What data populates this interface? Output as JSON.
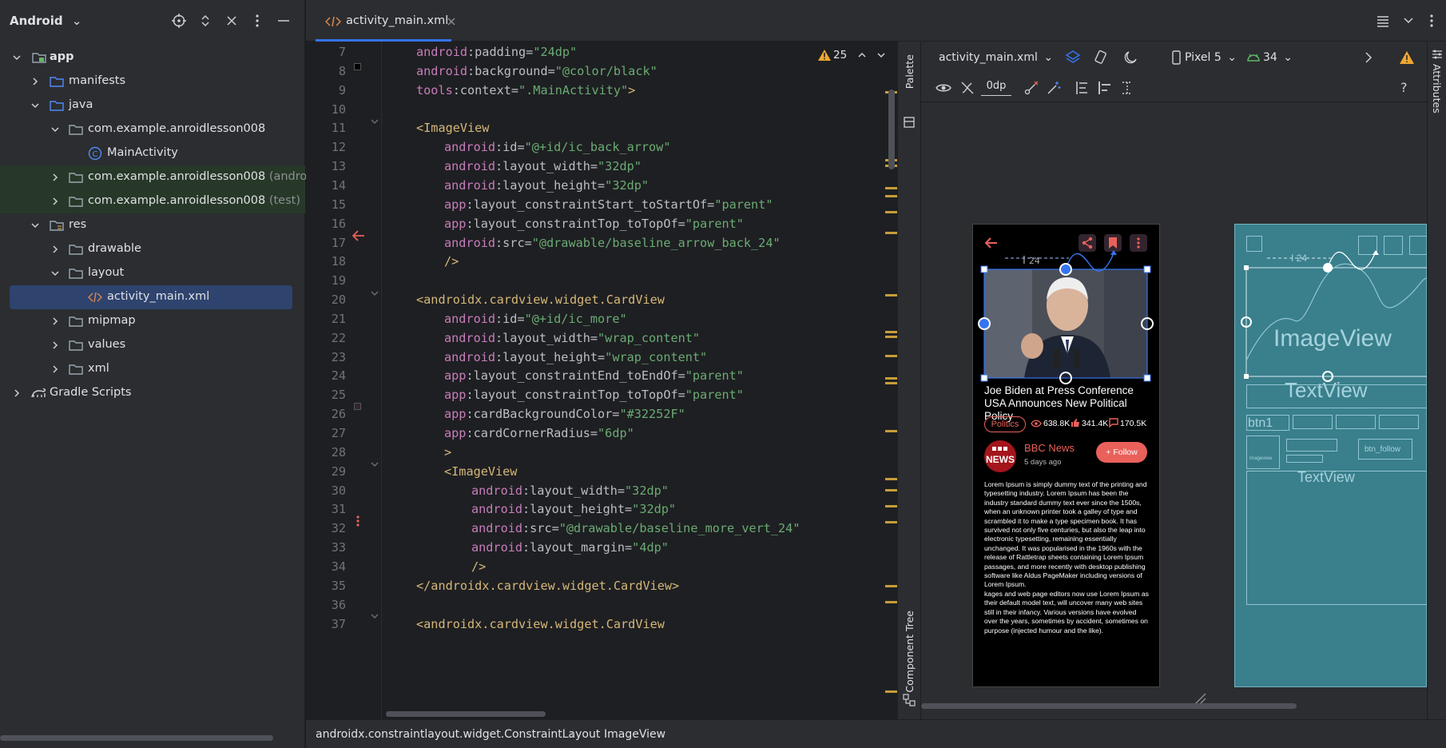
{
  "project": {
    "title": "Android",
    "tree": [
      {
        "label": "app",
        "bold": true
      },
      {
        "label": "manifests"
      },
      {
        "label": "java"
      },
      {
        "label": "com.example.anroidlesson008"
      },
      {
        "label": "MainActivity"
      },
      {
        "label": "com.example.anroidlesson008",
        "suffix": "(androidTe"
      },
      {
        "label": "com.example.anroidlesson008",
        "suffix": "(test)"
      },
      {
        "label": "res"
      },
      {
        "label": "drawable"
      },
      {
        "label": "layout"
      },
      {
        "label": "activity_main.xml"
      },
      {
        "label": "mipmap"
      },
      {
        "label": "values"
      },
      {
        "label": "xml"
      },
      {
        "label": "Gradle Scripts"
      }
    ]
  },
  "tabs": [
    {
      "label": "activity_main.xml"
    }
  ],
  "editor": {
    "inspection_count": "25",
    "lines": [
      {
        "n": "7",
        "parts": [
          [
            "ns",
            "android"
          ],
          [
            "attr",
            ":padding="
          ],
          [
            "str",
            "\"24dp\""
          ]
        ],
        "indent": 2
      },
      {
        "n": "8",
        "parts": [
          [
            "ns",
            "android"
          ],
          [
            "attr",
            ":background="
          ],
          [
            "str",
            "\"@color/black\""
          ]
        ],
        "indent": 2
      },
      {
        "n": "9",
        "parts": [
          [
            "ns",
            "tools"
          ],
          [
            "attr",
            ":context="
          ],
          [
            "str",
            "\".MainActivity\""
          ],
          [
            "br",
            ">"
          ]
        ],
        "indent": 2
      },
      {
        "n": "10",
        "parts": [],
        "indent": 0
      },
      {
        "n": "11",
        "parts": [
          [
            "br",
            "<"
          ],
          [
            "tag",
            "ImageView"
          ]
        ],
        "indent": 2
      },
      {
        "n": "12",
        "parts": [
          [
            "ns",
            "android"
          ],
          [
            "attr",
            ":id="
          ],
          [
            "str",
            "\"@+id/ic_back_arrow\""
          ]
        ],
        "indent": 3
      },
      {
        "n": "13",
        "parts": [
          [
            "ns",
            "android"
          ],
          [
            "attr",
            ":layout_width="
          ],
          [
            "str",
            "\"32dp\""
          ]
        ],
        "indent": 3
      },
      {
        "n": "14",
        "parts": [
          [
            "ns",
            "android"
          ],
          [
            "attr",
            ":layout_height="
          ],
          [
            "str",
            "\"32dp\""
          ]
        ],
        "indent": 3
      },
      {
        "n": "15",
        "parts": [
          [
            "ns",
            "app"
          ],
          [
            "attr",
            ":layout_constraintStart_toStartOf="
          ],
          [
            "str",
            "\"parent\""
          ]
        ],
        "indent": 3
      },
      {
        "n": "16",
        "parts": [
          [
            "ns",
            "app"
          ],
          [
            "attr",
            ":layout_constraintTop_toTopOf="
          ],
          [
            "str",
            "\"parent\""
          ]
        ],
        "indent": 3
      },
      {
        "n": "17",
        "parts": [
          [
            "ns",
            "android"
          ],
          [
            "attr",
            ":src="
          ],
          [
            "str",
            "\"@drawable/baseline_arrow_back_24\""
          ]
        ],
        "indent": 3
      },
      {
        "n": "18",
        "parts": [
          [
            "br",
            "/>"
          ]
        ],
        "indent": 3
      },
      {
        "n": "19",
        "parts": [],
        "indent": 0
      },
      {
        "n": "20",
        "parts": [
          [
            "br",
            "<"
          ],
          [
            "tag",
            "androidx.cardview.widget.CardView"
          ]
        ],
        "indent": 2
      },
      {
        "n": "21",
        "parts": [
          [
            "ns",
            "android"
          ],
          [
            "attr",
            ":id="
          ],
          [
            "str",
            "\"@+id/ic_more\""
          ]
        ],
        "indent": 3
      },
      {
        "n": "22",
        "parts": [
          [
            "ns",
            "android"
          ],
          [
            "attr",
            ":layout_width="
          ],
          [
            "str",
            "\"wrap_content\""
          ]
        ],
        "indent": 3
      },
      {
        "n": "23",
        "parts": [
          [
            "ns",
            "android"
          ],
          [
            "attr",
            ":layout_height="
          ],
          [
            "str",
            "\"wrap_content\""
          ]
        ],
        "indent": 3
      },
      {
        "n": "24",
        "parts": [
          [
            "ns",
            "app"
          ],
          [
            "attr",
            ":layout_constraintEnd_toEndOf="
          ],
          [
            "str",
            "\"parent\""
          ]
        ],
        "indent": 3
      },
      {
        "n": "25",
        "parts": [
          [
            "ns",
            "app"
          ],
          [
            "attr",
            ":layout_constraintTop_toTopOf="
          ],
          [
            "str",
            "\"parent\""
          ]
        ],
        "indent": 3
      },
      {
        "n": "26",
        "parts": [
          [
            "ns",
            "app"
          ],
          [
            "attr",
            ":cardBackgroundColor="
          ],
          [
            "str",
            "\"#32252F\""
          ]
        ],
        "indent": 3
      },
      {
        "n": "27",
        "parts": [
          [
            "ns",
            "app"
          ],
          [
            "attr",
            ":cardCornerRadius="
          ],
          [
            "str",
            "\"6dp\""
          ]
        ],
        "indent": 3
      },
      {
        "n": "28",
        "parts": [
          [
            "br",
            ">"
          ]
        ],
        "indent": 3
      },
      {
        "n": "29",
        "parts": [
          [
            "br",
            "<"
          ],
          [
            "tag",
            "ImageView"
          ]
        ],
        "indent": 3
      },
      {
        "n": "30",
        "parts": [
          [
            "ns",
            "android"
          ],
          [
            "attr",
            ":layout_width="
          ],
          [
            "str",
            "\"32dp\""
          ]
        ],
        "indent": 4
      },
      {
        "n": "31",
        "parts": [
          [
            "ns",
            "android"
          ],
          [
            "attr",
            ":layout_height="
          ],
          [
            "str",
            "\"32dp\""
          ]
        ],
        "indent": 4
      },
      {
        "n": "32",
        "parts": [
          [
            "ns",
            "android"
          ],
          [
            "attr",
            ":src="
          ],
          [
            "str",
            "\"@drawable/baseline_more_vert_24\""
          ]
        ],
        "indent": 4
      },
      {
        "n": "33",
        "parts": [
          [
            "ns",
            "android"
          ],
          [
            "attr",
            ":layout_margin="
          ],
          [
            "str",
            "\"4dp\""
          ]
        ],
        "indent": 4
      },
      {
        "n": "34",
        "parts": [
          [
            "br",
            "/>"
          ]
        ],
        "indent": 4
      },
      {
        "n": "35",
        "parts": [
          [
            "br",
            "</"
          ],
          [
            "tag",
            "androidx.cardview.widget.CardView"
          ],
          [
            "br",
            ">"
          ]
        ],
        "indent": 2
      },
      {
        "n": "36",
        "parts": [],
        "indent": 0
      },
      {
        "n": "37",
        "parts": [
          [
            "br",
            "<"
          ],
          [
            "tag",
            "androidx.cardview.widget.CardView"
          ]
        ],
        "indent": 2
      }
    ]
  },
  "side": {
    "palette": "Palette",
    "component_tree": "Component Tree",
    "attributes": "Attributes"
  },
  "design_toolbar": {
    "file": "activity_main.xml",
    "device": "Pixel 5",
    "api": "34",
    "margin": "0dp"
  },
  "preview": {
    "constraint_label": "24",
    "headline": "Joe Biden at Press Conference USA Announces New Political Policy",
    "category": "Politics",
    "views": "638.8K",
    "likes": "341.4K",
    "comments": "170.5K",
    "logo_text": "NEWS",
    "source": "BBC News",
    "time": "5 days ago",
    "follow": "Follow",
    "body": "Lorem Ipsum is simply dummy text of the printing and typesetting industry. Lorem Ipsum has been the industry standard dummy text ever since the 1500s, when an unknown printer took a galley of type and scrambled it to make a type specimen book. It has survived not only five centuries, but also the leap into electronic typesetting, remaining essentially unchanged. It was popularised in the 1960s with the release of Rattletrap sheets containing Lorem Ipsum passages, and more recently with desktop publishing software like Aldus PageMaker including versions of Lorem Ipsum.\nkages and web page editors now use Lorem Ipsum as their default model text, will uncover many web sites still in their infancy. Various versions have evolved over the years, sometimes by accident, sometimes on purpose (injected humour and the like)."
  },
  "blueprint": {
    "constraint_label": "24",
    "imageview": "ImageView",
    "textview1": "TextView",
    "btn1": "btn1",
    "imageview_small": "imageview",
    "btn_follow": "btn_follow",
    "textview2": "TextView"
  },
  "breadcrumb": [
    "androidx.constraintlayout.widget.ConstraintLayout",
    "ImageView"
  ],
  "colors": {
    "accent": "#3574f0",
    "brand": "#e9615a",
    "warning": "#f0a732"
  }
}
